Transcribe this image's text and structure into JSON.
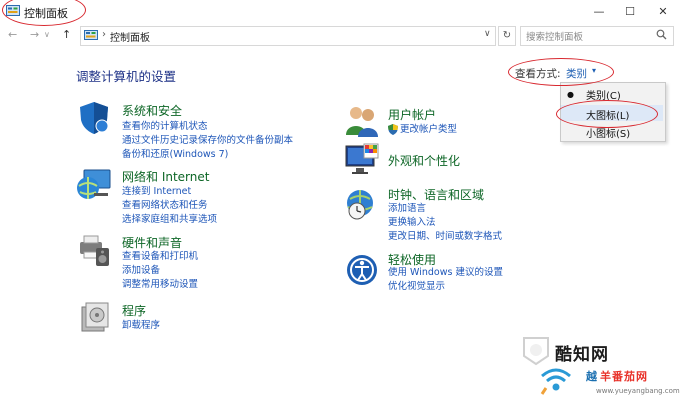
{
  "window": {
    "title": "控制面板",
    "minimize": "—",
    "maximize": "☐",
    "close": "✕"
  },
  "nav": {
    "back": "←",
    "forward": "→",
    "up": "↑",
    "dropdown": "∨",
    "refresh": "↻",
    "breadcrumb_sep": "›",
    "breadcrumb": "控制面板"
  },
  "search": {
    "placeholder": "搜索控制面板"
  },
  "page": {
    "heading": "调整计算机的设置"
  },
  "view": {
    "label": "查看方式:",
    "value": "类别",
    "caret": "▾",
    "options": [
      "类别(C)",
      "大图标(L)",
      "小图标(S)"
    ],
    "selected_bullet": "●"
  },
  "categories": {
    "system": {
      "title": "系统和安全",
      "links": [
        "查看你的计算机状态",
        "通过文件历史记录保存你的文件备份副本",
        "备份和还原(Windows 7)"
      ]
    },
    "network": {
      "title": "网络和 Internet",
      "links": [
        "连接到 Internet",
        "查看网络状态和任务",
        "选择家庭组和共享选项"
      ]
    },
    "hardware": {
      "title": "硬件和声音",
      "links": [
        "查看设备和打印机",
        "添加设备",
        "调整常用移动设置"
      ]
    },
    "programs": {
      "title": "程序",
      "links": [
        "卸载程序"
      ]
    },
    "user": {
      "title": "用户帐户",
      "links": [
        "更改帐户类型"
      ]
    },
    "appearance": {
      "title": "外观和个性化",
      "links": []
    },
    "clock": {
      "title": "时钟、语言和区域",
      "links": [
        "添加语言",
        "更换输入法",
        "更改日期、时间或数字格式"
      ]
    },
    "ease": {
      "title": "轻松使用",
      "links": [
        "使用 Windows 建议的设置",
        "优化视觉显示"
      ]
    }
  },
  "watermark": {
    "brand": "酷知网",
    "sub_prefix": "越",
    "sub_name": "羊番茄网",
    "url": "www.yueyangbang.com"
  },
  "colors": {
    "heading": "#1e3287",
    "category_title": "#0d6626",
    "link": "#1e56b8",
    "annotation": "#d8282f"
  }
}
